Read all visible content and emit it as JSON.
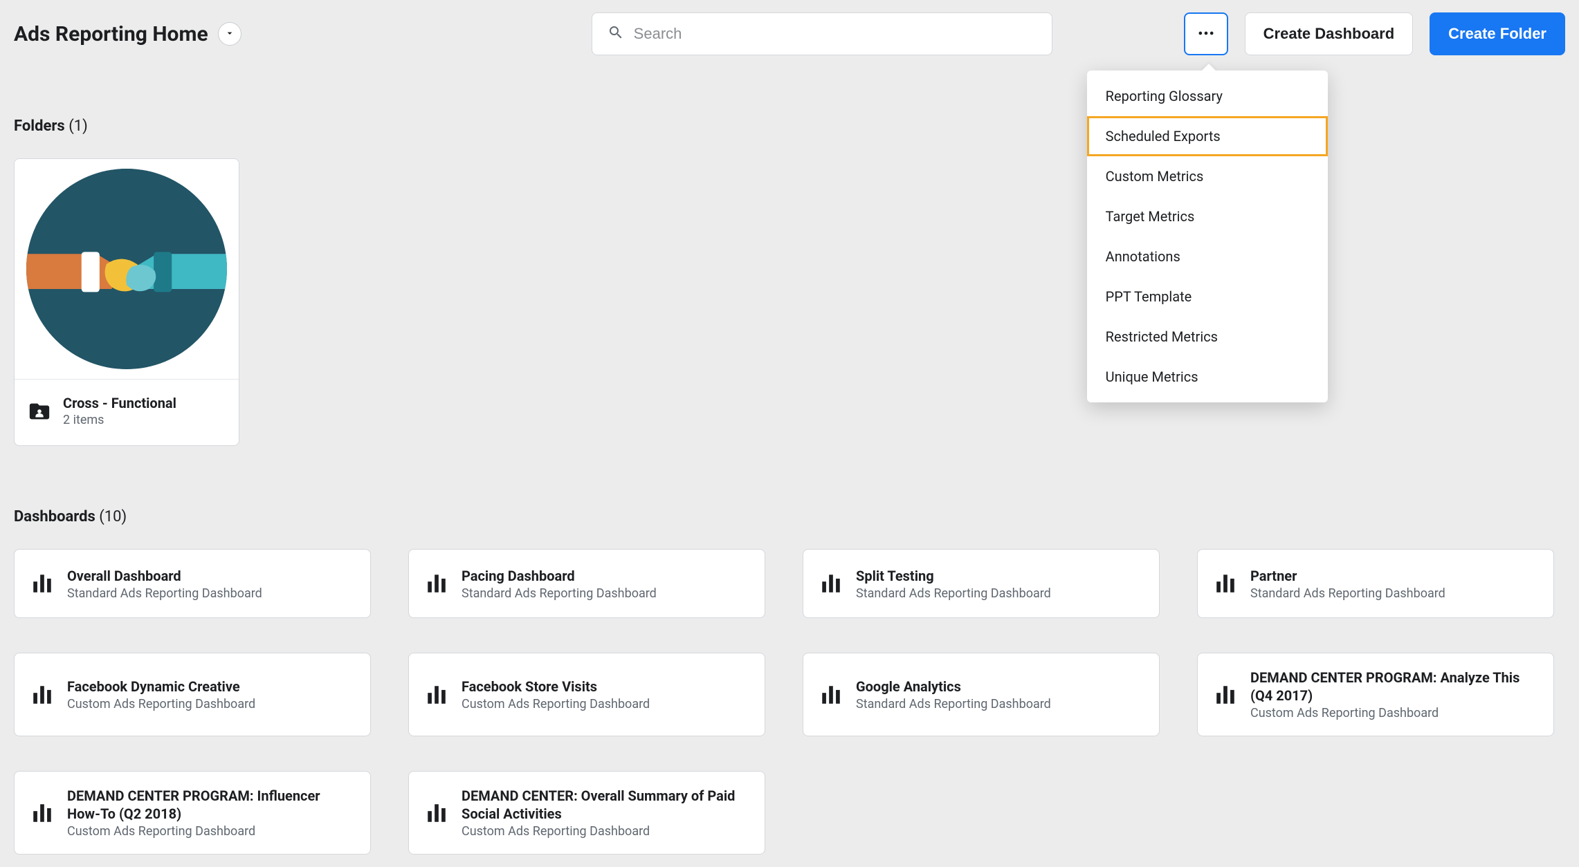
{
  "header": {
    "title": "Ads Reporting Home",
    "search_placeholder": "Search",
    "create_dashboard": "Create Dashboard",
    "create_folder": "Create Folder"
  },
  "menu": {
    "items": [
      "Reporting Glossary",
      "Scheduled Exports",
      "Custom Metrics",
      "Target Metrics",
      "Annotations",
      "PPT Template",
      "Restricted Metrics",
      "Unique Metrics"
    ],
    "highlighted_index": 1
  },
  "folders": {
    "heading": "Folders",
    "count_text": "(1)",
    "items": [
      {
        "name": "Cross - Functional",
        "subtitle": "2 items"
      }
    ]
  },
  "dashboards": {
    "heading": "Dashboards",
    "count_text": "(10)",
    "items": [
      {
        "title": "Overall Dashboard",
        "subtitle": "Standard Ads Reporting Dashboard"
      },
      {
        "title": "Pacing Dashboard",
        "subtitle": "Standard Ads Reporting Dashboard"
      },
      {
        "title": "Split Testing",
        "subtitle": "Standard Ads Reporting Dashboard"
      },
      {
        "title": "Partner",
        "subtitle": "Standard Ads Reporting Dashboard"
      },
      {
        "title": "Facebook Dynamic Creative",
        "subtitle": "Custom Ads Reporting Dashboard"
      },
      {
        "title": "Facebook Store Visits",
        "subtitle": "Custom Ads Reporting Dashboard"
      },
      {
        "title": "Google Analytics",
        "subtitle": "Standard Ads Reporting Dashboard"
      },
      {
        "title": "DEMAND CENTER PROGRAM: Analyze This (Q4 2017)",
        "subtitle": "Custom Ads Reporting Dashboard"
      },
      {
        "title": "DEMAND CENTER PROGRAM: Influencer How-To (Q2 2018)",
        "subtitle": "Custom Ads Reporting Dashboard"
      },
      {
        "title": "DEMAND CENTER: Overall Summary of Paid Social Activities",
        "subtitle": "Custom Ads Reporting Dashboard"
      }
    ]
  }
}
